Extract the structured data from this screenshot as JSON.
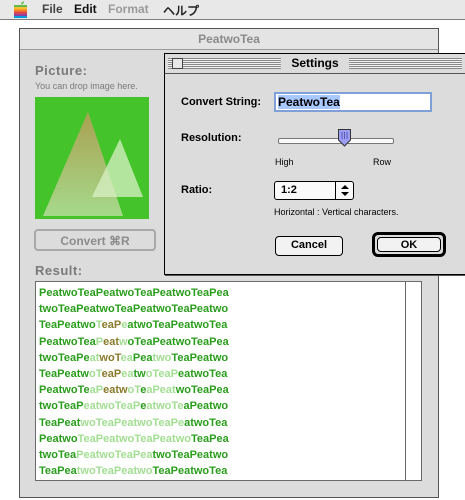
{
  "menubar": {
    "items": [
      {
        "label": "File"
      },
      {
        "label": "Edit"
      },
      {
        "label": "Format"
      },
      {
        "label": "ヘルプ"
      }
    ]
  },
  "main_window": {
    "title": "PeatwoTea",
    "picture_label": "Picture:",
    "picture_hint": "You can drop image here.",
    "convert_button": "Convert ⌘R",
    "result_label": "Result:",
    "result_lines": [
      "PeatwoTeaPeatwoTeaPeatwoTeaPea",
      "twoTeaPeatwoTeaPeatwoTeaPeatwo",
      "TeaPeatwoTeaPeatwoTeaPeatwoTea",
      "PeatwoTeaPeatwoTeaPeatwoTeaPea",
      "twoTeaPeatwoTeaPeatwoTeaPeatwo",
      "TeaPeatwoTeaPeatwoTeaPeatwoTea",
      "PeatwoTeaPeatwoTeaPeatwoTeaPea",
      "twoTeaPeatwoTeaPeatwoTeaPeatwo",
      "TeaPeatwoTeaPeatwoTeaPeatwoTea",
      "PeatwoTeaPeatwoTeaPeatwoTeaPea",
      "twoTeaPeatwoTeaPeatwoTeaPeatwo",
      "TeaPeatwoTeaPeatwoTeaPeatwoTea"
    ],
    "colors": {
      "picture_bg": "#44c42a",
      "text_green": "#2a9e1c",
      "text_pale": "#a2de92",
      "text_olive": "#8a7a2a"
    }
  },
  "settings": {
    "title": "Settings",
    "convert_string_label": "Convert String:",
    "convert_string_value": "PeatwoTea",
    "resolution_label": "Resolution:",
    "resolution_value": 0.58,
    "resolution_high": "High",
    "resolution_low": "Row",
    "ratio_label": "Ratio:",
    "ratio_value": "1:2",
    "ratio_hint": "Horizontal : Vertical characters.",
    "cancel_label": "Cancel",
    "ok_label": "OK"
  }
}
